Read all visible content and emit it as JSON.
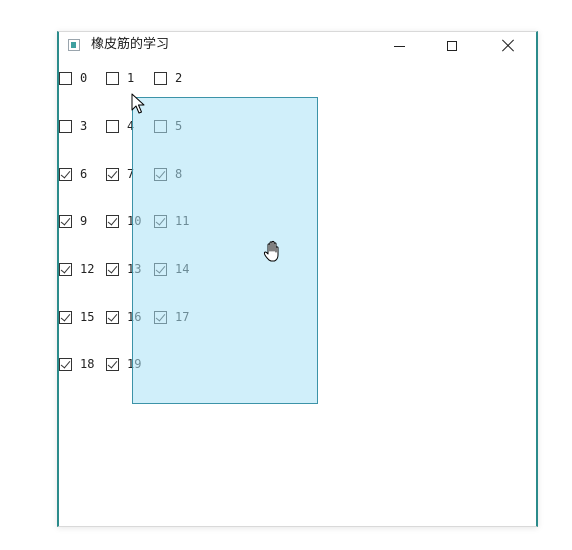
{
  "window": {
    "title": "橡皮筋的学习",
    "controls": {
      "minimize": "minimize",
      "maximize": "maximize",
      "close": "close"
    }
  },
  "checkboxes": [
    {
      "label": "0",
      "checked": false
    },
    {
      "label": "1",
      "checked": false
    },
    {
      "label": "2",
      "checked": false
    },
    {
      "label": "3",
      "checked": false
    },
    {
      "label": "4",
      "checked": false
    },
    {
      "label": "5",
      "checked": false
    },
    {
      "label": "6",
      "checked": true
    },
    {
      "label": "7",
      "checked": true
    },
    {
      "label": "8",
      "checked": true
    },
    {
      "label": "9",
      "checked": true
    },
    {
      "label": "10",
      "checked": true
    },
    {
      "label": "11",
      "checked": true
    },
    {
      "label": "12",
      "checked": true
    },
    {
      "label": "13",
      "checked": true
    },
    {
      "label": "14",
      "checked": true
    },
    {
      "label": "15",
      "checked": true
    },
    {
      "label": "16",
      "checked": true
    },
    {
      "label": "17",
      "checked": true
    },
    {
      "label": "18",
      "checked": true
    },
    {
      "label": "19",
      "checked": true
    }
  ],
  "colors": {
    "rubber_band_fill": "#aae1f5",
    "rubber_band_border": "#3c93a8",
    "window_accent": "#2b8b8b"
  },
  "icons": {
    "app": "app-window-icon",
    "pointer": "arrow-cursor-icon",
    "hand": "open-hand-cursor-icon"
  }
}
